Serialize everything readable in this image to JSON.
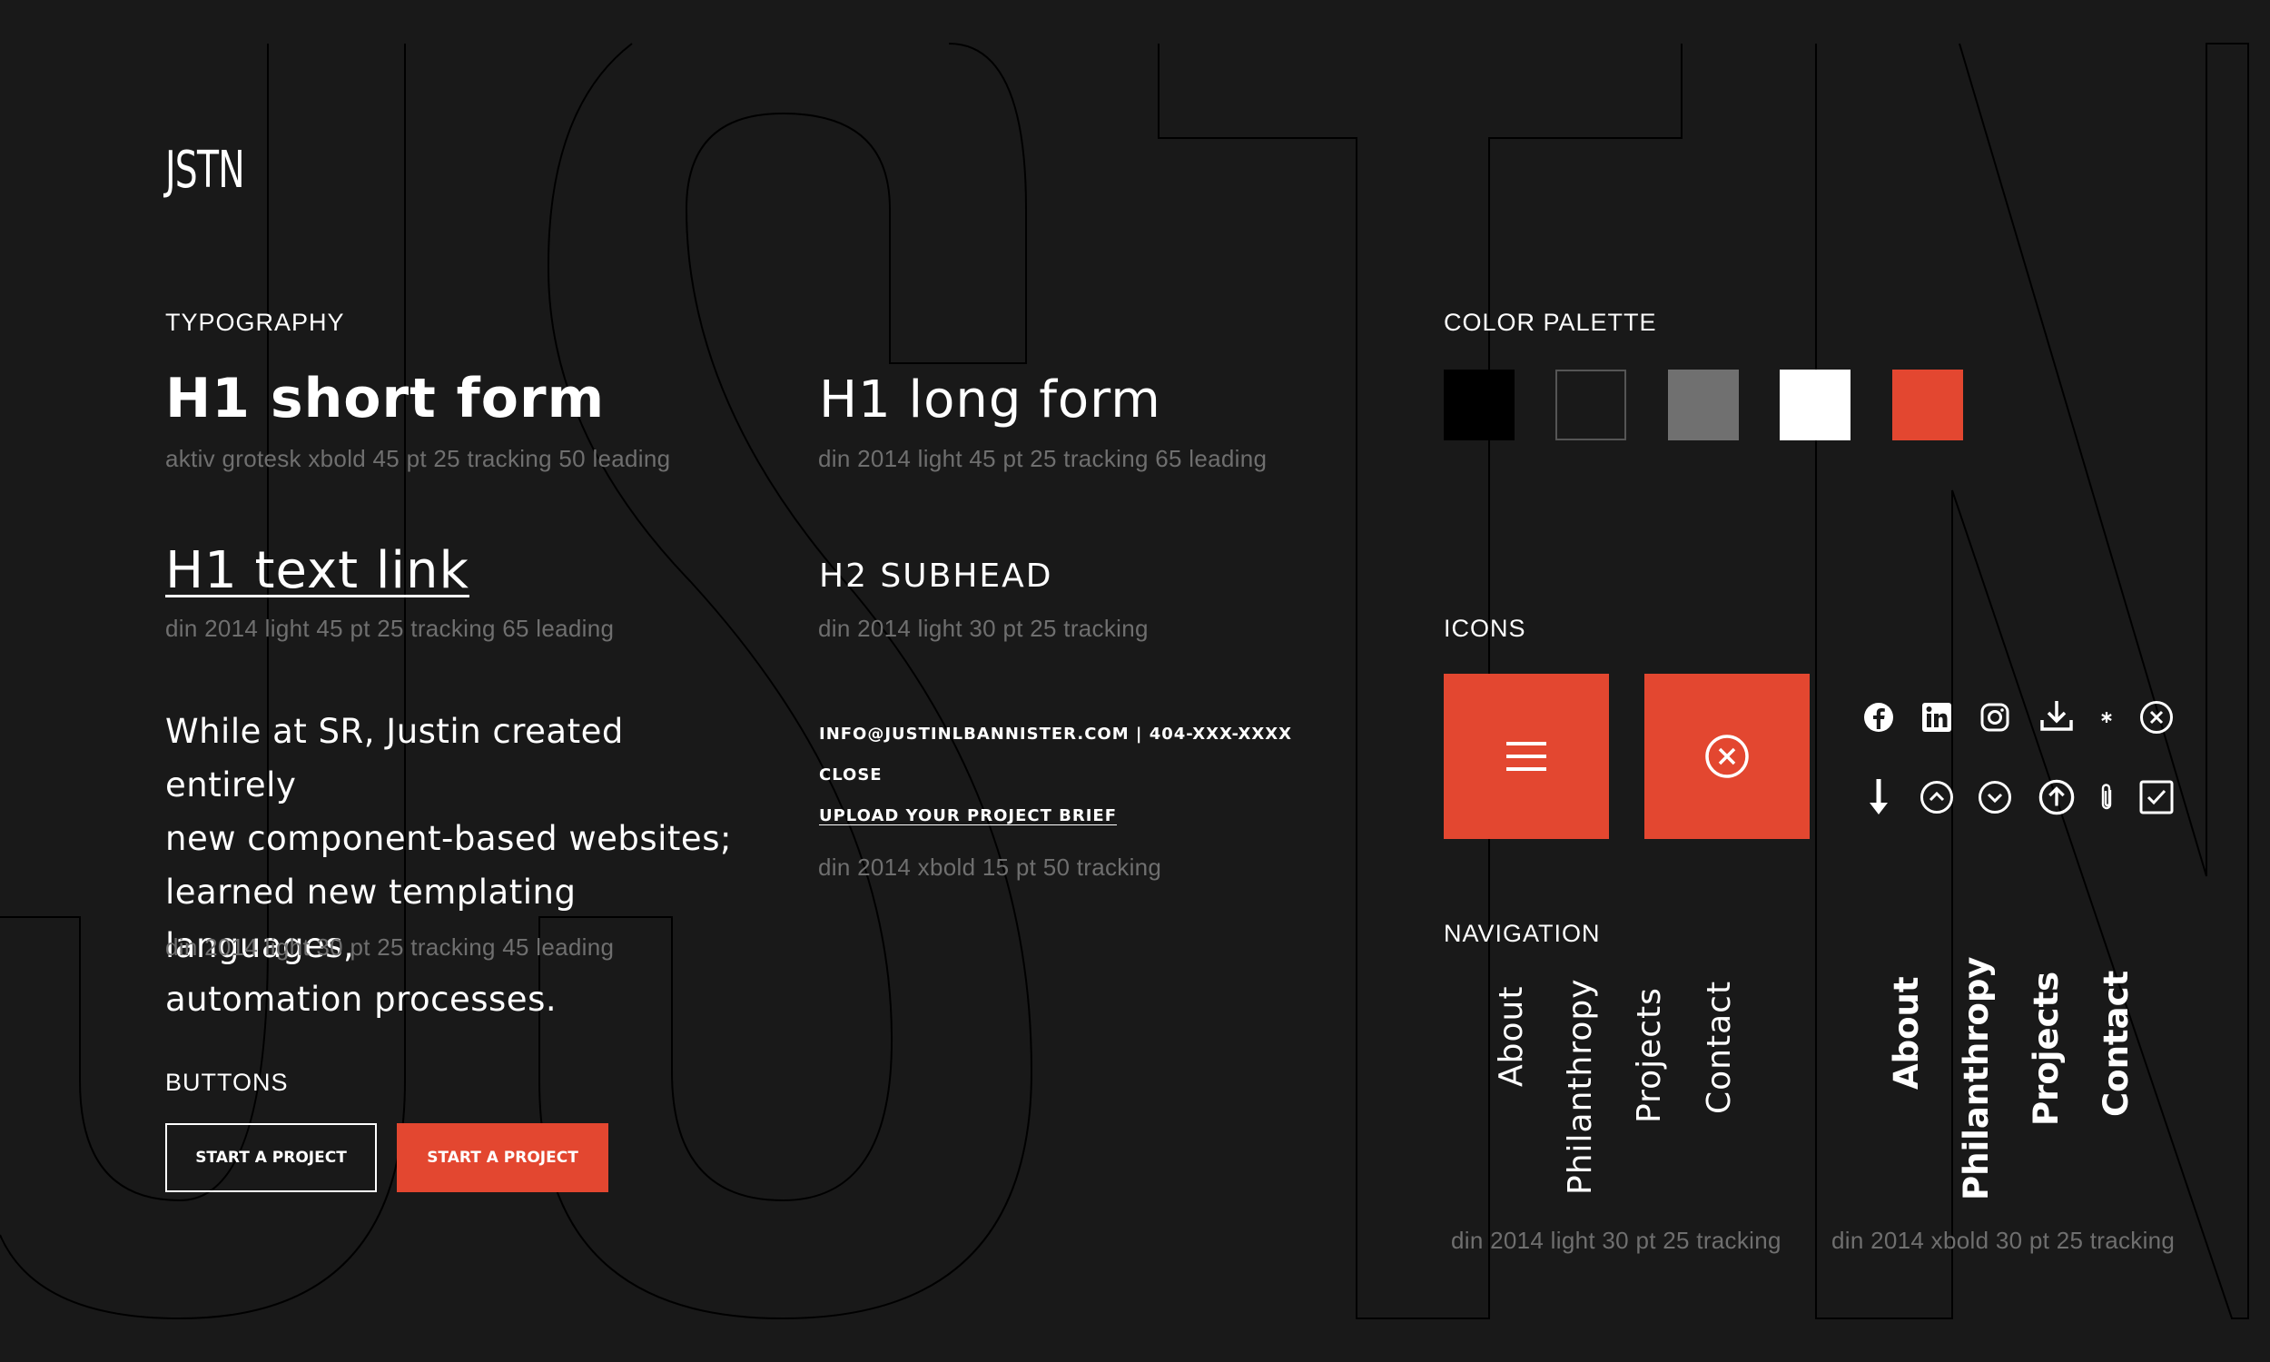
{
  "logo": "JSTN",
  "background_word": "JSTN",
  "typography": {
    "section_label": "TYPOGRAPHY",
    "h1_short": "H1 short form",
    "h1_short_spec": "aktiv grotesk xbold 45 pt 25 tracking 50 leading",
    "h1_long": "H1 long form",
    "h1_long_spec": "din 2014 light 45 pt 25 tracking 65 leading",
    "h1_link": "H1 text link",
    "h1_link_spec": "din 2014 light 45 pt 25 tracking 65 leading",
    "h2": "H2 SUBHEAD",
    "h2_spec": "din 2014 light 30 pt 25 tracking",
    "body_lines": [
      "While at SR, Justin created entirely",
      "new component-based websites;",
      "learned new templating languages,",
      "automation processes."
    ],
    "body_spec": "din 2014 light 30 pt 25 tracking 45 leading",
    "contact_line": "INFO@JUSTINLBANNISTER.COM  |  404-XXX-XXXX",
    "close_label": "CLOSE",
    "upload_link": "UPLOAD YOUR PROJECT BRIEF",
    "small_spec": "din 2014 xbold 15 pt 50 tracking"
  },
  "buttons": {
    "section_label": "BUTTONS",
    "outline_label": "START A PROJECT",
    "solid_label": "START A PROJECT"
  },
  "color_palette": {
    "section_label": "COLOR PALETTE",
    "swatches": [
      "#000000",
      "#191919",
      "#707070",
      "#ffffff",
      "#e34730"
    ]
  },
  "icons": {
    "section_label": "ICONS",
    "tiles": [
      "hamburger-menu-icon",
      "close-circle-icon"
    ],
    "row1": [
      "facebook-icon",
      "linkedin-icon",
      "instagram-icon",
      "download-icon",
      "asterisk-icon",
      "close-circle-icon"
    ],
    "row2": [
      "arrow-down-icon",
      "chevron-up-circle-icon",
      "chevron-down-circle-icon",
      "arrow-up-circle-icon",
      "paperclip-icon",
      "checkbox-icon"
    ]
  },
  "navigation": {
    "section_label": "NAVIGATION",
    "light_items": [
      "About",
      "Philanthropy",
      "Projects",
      "Contact"
    ],
    "light_spec": "din 2014 light 30 pt 25 tracking",
    "bold_items": [
      "About",
      "Philanthropy",
      "Projects",
      "Contact"
    ],
    "bold_spec": "din 2014 xbold 30 pt 25 tracking"
  },
  "colors": {
    "background": "#191919",
    "accent": "#e34730",
    "muted_text": "#6f6f6f",
    "outline": "#000000"
  }
}
